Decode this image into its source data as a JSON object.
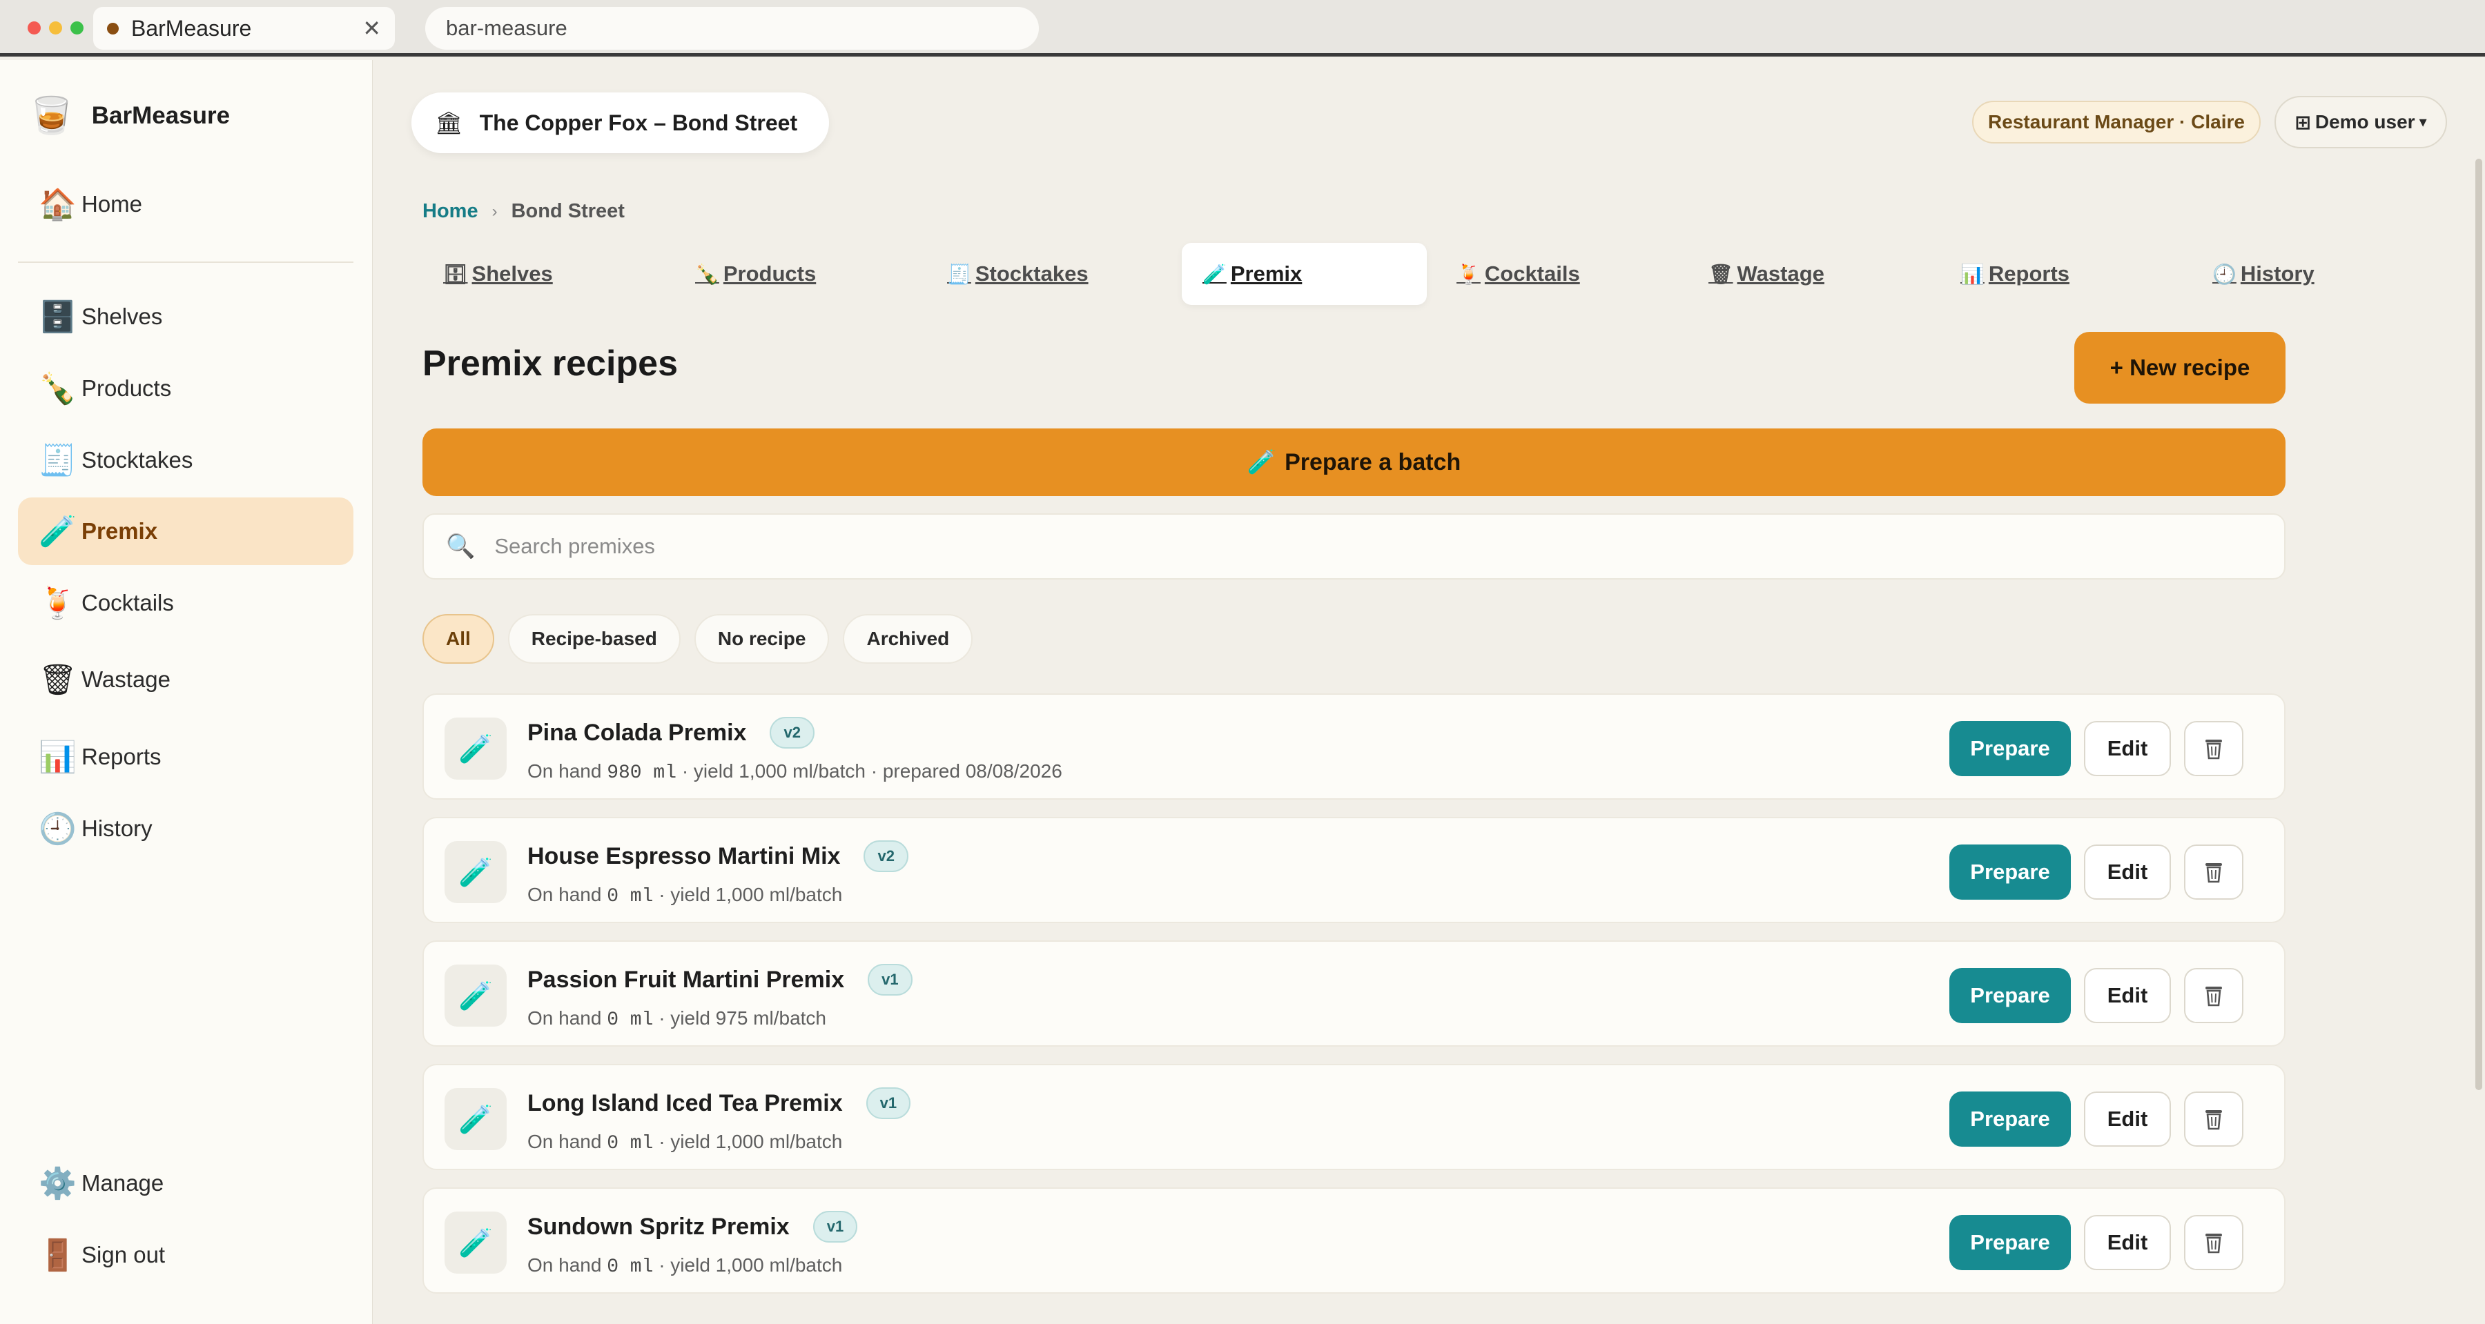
{
  "browser": {
    "tab_title": "BarMeasure",
    "tab_close": "✕",
    "address": "bar-measure"
  },
  "sidebar": {
    "brand": "BarMeasure",
    "brand_icon": "🥃",
    "items": [
      {
        "label": "Home",
        "icon": "🏠",
        "icon_name": "home-icon"
      },
      {
        "label": "Shelves",
        "icon": "🗄️",
        "icon_name": "cabinet-icon"
      },
      {
        "label": "Products",
        "icon": "🍾",
        "icon_name": "bottle-icon"
      },
      {
        "label": "Stocktakes",
        "icon": "🧾",
        "icon_name": "receipt-icon"
      },
      {
        "label": "Premix",
        "icon": "🧪",
        "icon_name": "test-tube-icon"
      },
      {
        "label": "Cocktails",
        "icon": "🍹",
        "icon_name": "cocktail-icon"
      },
      {
        "label": "Wastage",
        "icon": "🗑",
        "icon_name": "waste-bin-icon"
      },
      {
        "label": "Reports",
        "icon": "📊",
        "icon_name": "bar-chart-icon"
      },
      {
        "label": "History",
        "icon": "🕘",
        "icon_name": "clock-icon"
      },
      {
        "label": "Manage",
        "icon": "⚙️",
        "icon_name": "gear-icon"
      },
      {
        "label": "Sign out",
        "icon": "🚪",
        "icon_name": "door-icon"
      }
    ],
    "active": "Premix"
  },
  "header": {
    "venue_icon": "🏛",
    "venue": "The Copper Fox – Bond Street",
    "role": "Restaurant Manager · Claire",
    "user_icon": "⊞",
    "user": "Demo user",
    "user_chevron": "▾"
  },
  "breadcrumb": {
    "home": "Home",
    "separator": "›",
    "current": "Bond Street"
  },
  "tabs": [
    {
      "label": "Shelves",
      "icon": "🗄"
    },
    {
      "label": "Products",
      "icon": "🍾"
    },
    {
      "label": "Stocktakes",
      "icon": "🧾"
    },
    {
      "label": "Premix",
      "icon": "🧪"
    },
    {
      "label": "Cocktails",
      "icon": "🍹"
    },
    {
      "label": "Wastage",
      "icon": "🗑"
    },
    {
      "label": "Reports",
      "icon": "📊"
    },
    {
      "label": "History",
      "icon": "🕘"
    }
  ],
  "page": {
    "title": "Premix recipes",
    "new_recipe": "+ New recipe",
    "batch_icon": "🧪",
    "prepare_batch": "Prepare a batch",
    "search_icon": "🔍",
    "search_placeholder": "Search premixes"
  },
  "filters": [
    "All",
    "Recipe-based",
    "No recipe",
    "Archived"
  ],
  "active_filter": "All",
  "premixes": [
    {
      "icon": "🧪",
      "name": "Pina Colada Premix",
      "version": "v2",
      "on_hand_label": "On hand",
      "on_hand": "980 ml",
      "details": " · yield 1,000 ml/batch · prepared 08/08/2026"
    },
    {
      "icon": "🧪",
      "name": "House Espresso Martini Mix",
      "version": "v2",
      "on_hand_label": "On hand",
      "on_hand": "0 ml",
      "details": " · yield 1,000 ml/batch"
    },
    {
      "icon": "🧪",
      "name": "Passion Fruit Martini Premix",
      "version": "v1",
      "on_hand_label": "On hand",
      "on_hand": "0 ml",
      "details": " · yield 975 ml/batch"
    },
    {
      "icon": "🧪",
      "name": "Long Island Iced Tea Premix",
      "version": "v1",
      "on_hand_label": "On hand",
      "on_hand": "0 ml",
      "details": " · yield 1,000 ml/batch"
    },
    {
      "icon": "🧪",
      "name": "Sundown Spritz Premix",
      "version": "v1",
      "on_hand_label": "On hand",
      "on_hand": "0 ml",
      "details": " · yield 1,000 ml/batch"
    }
  ],
  "row_actions": {
    "prepare": "Prepare",
    "edit": "Edit"
  },
  "colors": {
    "accent_orange": "#e79022",
    "teal": "#178b91",
    "active_nav": "#fae4c6",
    "background": "#f2efe8"
  }
}
